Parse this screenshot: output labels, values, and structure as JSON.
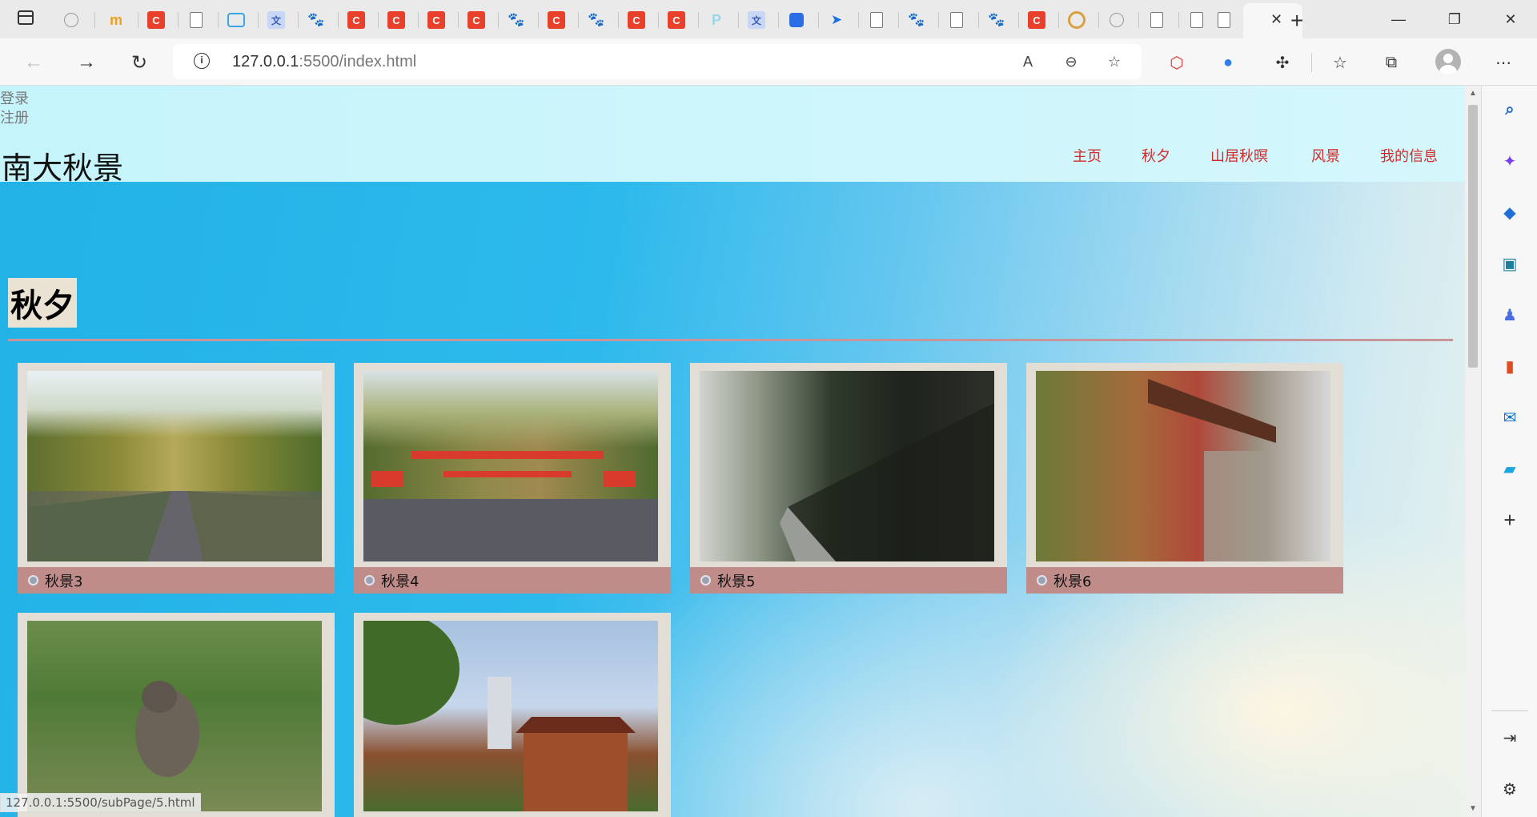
{
  "browser": {
    "tab_favicons": [
      "sidebar",
      "doc-dim",
      "m",
      "c",
      "doc",
      "tv",
      "translate",
      "paw",
      "c",
      "c",
      "c",
      "c",
      "paw",
      "c",
      "paw",
      "c",
      "c",
      "p",
      "translate",
      "blue-doc",
      "bird",
      "doc",
      "paw",
      "doc",
      "paw",
      "c",
      "circle",
      "doc-dim",
      "doc",
      "doc",
      "doc"
    ],
    "active_tab_close": "✕",
    "new_tab": "+",
    "window_controls": {
      "minimize": "—",
      "maximize": "❐",
      "close": "✕"
    },
    "address": {
      "host": "127.0.0.1",
      "rest": ":5500/index.html"
    },
    "status_url": "127.0.0.1:5500/subPage/5.html"
  },
  "header": {
    "login": "登录",
    "register": "注册",
    "site_title": "南大秋景",
    "nav": [
      "主页",
      "秋夕",
      "山居秋暝",
      "风景",
      "我的信息"
    ]
  },
  "main": {
    "section_heading": "秋夕",
    "cards": [
      {
        "caption": "秋景3",
        "photo": "road1"
      },
      {
        "caption": "秋景4",
        "photo": "road2"
      },
      {
        "caption": "秋景5",
        "photo": "ivy"
      },
      {
        "caption": "秋景6",
        "photo": "bldg"
      },
      {
        "caption": "",
        "photo": "cat"
      },
      {
        "caption": "",
        "photo": "tower"
      }
    ]
  },
  "colors": {
    "nav_link": "#d12a2a",
    "caption_bg": "#c08c8a",
    "divider": "#c9949a",
    "header_bg": "#c5f4fb"
  }
}
